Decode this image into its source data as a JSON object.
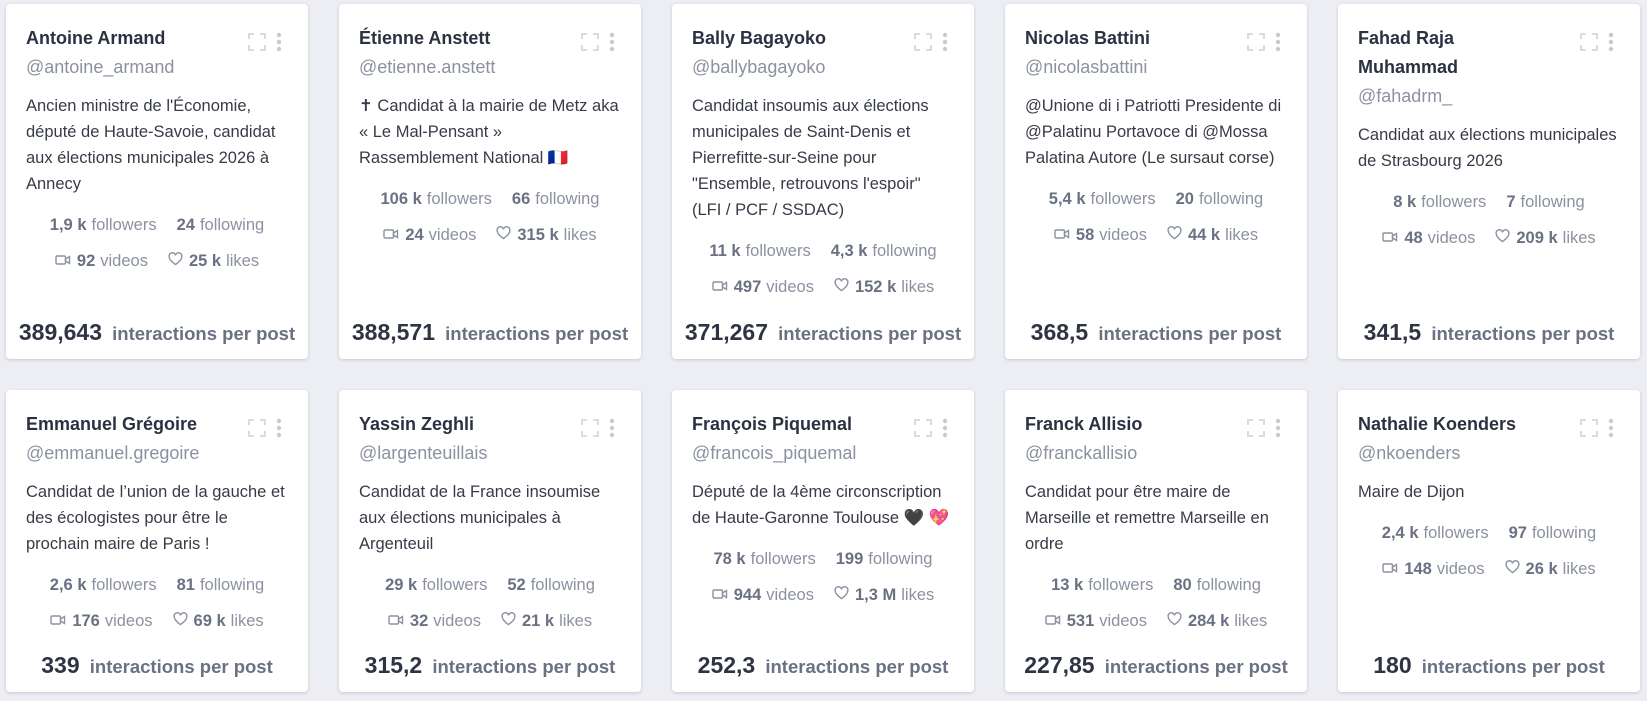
{
  "labels": {
    "followers": "followers",
    "following": "following",
    "videos": "videos",
    "likes": "likes",
    "interactions_per_post": "interactions per post"
  },
  "cards": [
    {
      "name": "Antoine Armand",
      "handle": "@antoine_armand",
      "bio": "Ancien ministre de l'Économie, député de Haute-Savoie, candidat aux élections municipales 2026 à Annecy",
      "followers": "1,9 k",
      "following": "24",
      "videos": "92",
      "likes": "25 k",
      "interactions_per_post": "389,643"
    },
    {
      "name": "Étienne Anstett",
      "handle": "@etienne.anstett",
      "bio": "✝ Candidat à la mairie de Metz aka « Le Mal-Pensant » Rassemblement National 🇫🇷",
      "followers": "106 k",
      "following": "66",
      "videos": "24",
      "likes": "315 k",
      "interactions_per_post": "388,571"
    },
    {
      "name": "Bally Bagayoko",
      "handle": "@ballybagayoko",
      "bio": "Candidat insoumis aux élections municipales de Saint-Denis et Pierrefitte-sur-Seine pour \"Ensemble, retrouvons l'espoir\" (LFI / PCF / SSDAC)",
      "followers": "11 k",
      "following": "4,3 k",
      "videos": "497",
      "likes": "152 k",
      "interactions_per_post": "371,267"
    },
    {
      "name": "Nicolas Battini",
      "handle": "@nicolasbattini",
      "bio": "@Unione di i Patriotti Presidente di @Palatinu Portavoce di @Mossa Palatina Autore (Le sursaut corse)",
      "followers": "5,4 k",
      "following": "20",
      "videos": "58",
      "likes": "44 k",
      "interactions_per_post": "368,5"
    },
    {
      "name": "Fahad Raja Muhammad",
      "handle": "@fahadrm_",
      "bio": "Candidat aux élections municipales de Strasbourg 2026",
      "followers": "8 k",
      "following": "7",
      "videos": "48",
      "likes": "209 k",
      "interactions_per_post": "341,5"
    },
    {
      "name": "Emmanuel Grégoire",
      "handle": "@emmanuel.gregoire",
      "bio": "Candidat de l’union de la gauche et des écologistes pour être le prochain maire de Paris !",
      "followers": "2,6 k",
      "following": "81",
      "videos": "176",
      "likes": "69 k",
      "interactions_per_post": "339"
    },
    {
      "name": "Yassin Zeghli",
      "handle": "@largenteuillais",
      "bio": "Candidat de la France insoumise aux élections municipales à Argenteuil",
      "followers": "29 k",
      "following": "52",
      "videos": "32",
      "likes": "21 k",
      "interactions_per_post": "315,2"
    },
    {
      "name": "François Piquemal",
      "handle": "@francois_piquemal",
      "bio": "Député de la 4ème circonscription de Haute-Garonne Toulouse 🖤 💖",
      "followers": "78 k",
      "following": "199",
      "videos": "944",
      "likes": "1,3 M",
      "interactions_per_post": "252,3"
    },
    {
      "name": "Franck Allisio",
      "handle": "@franckallisio",
      "bio": "Candidat pour être maire de Marseille et remettre Marseille en ordre",
      "followers": "13 k",
      "following": "80",
      "videos": "531",
      "likes": "284 k",
      "interactions_per_post": "227,85"
    },
    {
      "name": "Nathalie Koenders",
      "handle": "@nkoenders",
      "bio": "Maire de Dijon",
      "followers": "2,4 k",
      "following": "97",
      "videos": "148",
      "likes": "26 k",
      "interactions_per_post": "180"
    }
  ]
}
